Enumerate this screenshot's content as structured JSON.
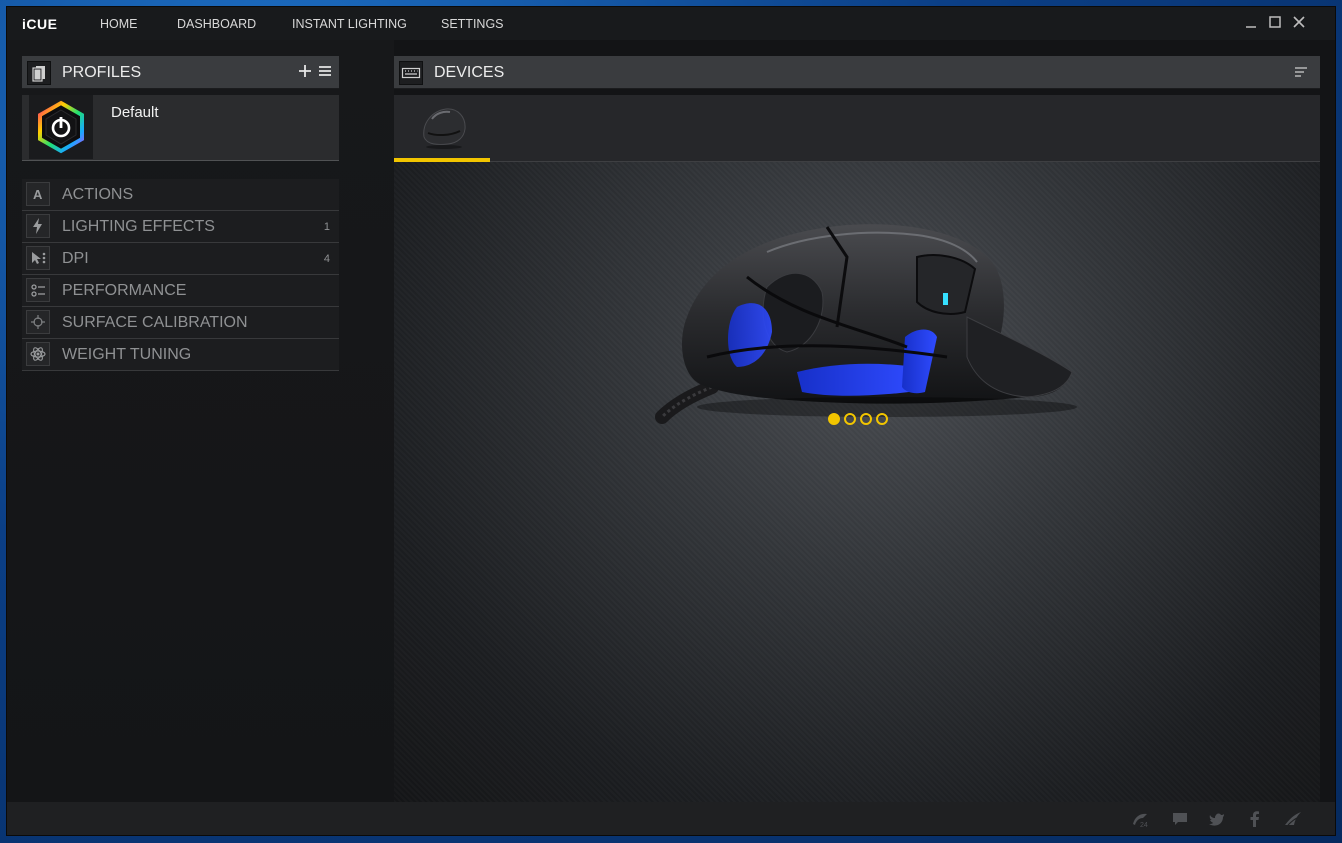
{
  "app": {
    "logo": "iCUE",
    "nav": [
      "HOME",
      "DASHBOARD",
      "INSTANT LIGHTING",
      "SETTINGS"
    ]
  },
  "profiles": {
    "title": "PROFILES",
    "items": [
      {
        "name": "Default"
      }
    ]
  },
  "sidebar": {
    "items": [
      {
        "label": "ACTIONS",
        "count": "",
        "icon": "letter-a-icon"
      },
      {
        "label": "LIGHTING EFFECTS",
        "count": "1",
        "icon": "lightning-icon"
      },
      {
        "label": "DPI",
        "count": "4",
        "icon": "dpi-icon"
      },
      {
        "label": "PERFORMANCE",
        "count": "",
        "icon": "sliders-icon"
      },
      {
        "label": "SURFACE CALIBRATION",
        "count": "",
        "icon": "crosshair-icon"
      },
      {
        "label": "WEIGHT TUNING",
        "count": "",
        "icon": "weight-icon"
      }
    ]
  },
  "devices": {
    "title": "DEVICES",
    "selected_index": 0,
    "carousel_pages": 4,
    "carousel_active": 0
  },
  "colors": {
    "accent": "#f2c500",
    "mouse_led": "#1e3fff"
  },
  "footer": {
    "icons": [
      "corsair-24-icon",
      "chat-icon",
      "twitter-icon",
      "facebook-icon",
      "corsair-sails-icon"
    ]
  }
}
